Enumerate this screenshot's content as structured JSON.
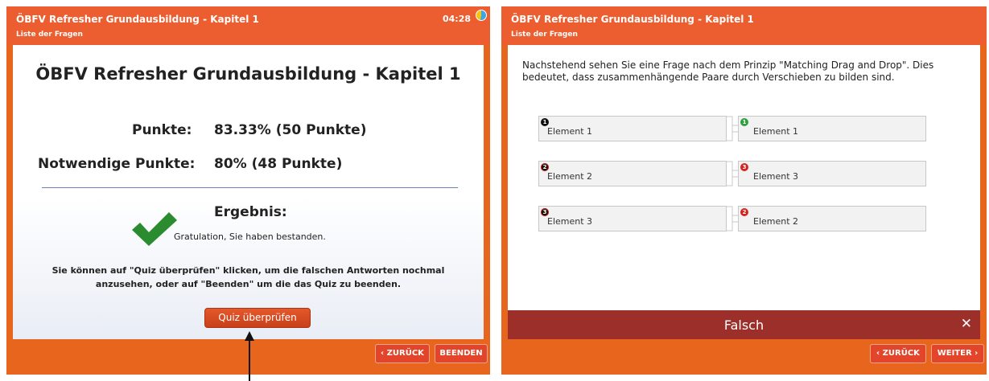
{
  "left": {
    "header": {
      "title": "ÖBFV Refresher Grundausbildung - Kapitel 1",
      "subtitle": "Liste der Fragen",
      "timer": "04:28"
    },
    "main_title": "ÖBFV Refresher Grundausbildung - Kapitel 1",
    "points_label": "Punkte:",
    "points_value": "83.33% (50 Punkte)",
    "required_label": "Notwendige Punkte:",
    "required_value": "80% (48 Punkte)",
    "result_title": "Ergebnis:",
    "result_message": "Gratulation, Sie haben bestanden.",
    "info_text": "Sie können auf \"Quiz überprüfen\" klicken, um die falschen Antworten nochmal anzusehen, oder auf \"Beenden\" um die das Quiz zu beenden.",
    "review_button": "Quiz überprüfen",
    "back_button": "‹ ZURÜCK",
    "finish_button": "BEENDEN"
  },
  "right": {
    "header": {
      "title": "ÖBFV Refresher Grundausbildung - Kapitel 1",
      "subtitle": "Liste der Fragen"
    },
    "question": "Nachstehend sehen Sie eine Frage nach dem Prinzip \"Matching Drag and Drop\". Dies bedeutet, dass zusammenhängende Paare durch Verschieben zu bilden sind.",
    "pairs": [
      {
        "left_label": "Element 1",
        "left_badge": "1",
        "right_label": "Element 1",
        "right_badge": "1",
        "right_status": "correct"
      },
      {
        "left_label": "Element 2",
        "left_badge": "2",
        "right_label": "Element 3",
        "right_badge": "3",
        "right_status": "wrong"
      },
      {
        "left_label": "Element 3",
        "left_badge": "3",
        "right_label": "Element 2",
        "right_badge": "2",
        "right_status": "wrong"
      }
    ],
    "feedback": "Falsch",
    "close_symbol": "✕",
    "back_button": "‹ ZURÜCK",
    "next_button": "WEITER ›"
  },
  "colors": {
    "frame": "#e8651e",
    "header": "#ec5d2f",
    "wrong_bar": "#9c2f2a",
    "correct_badge": "#2e9e3e",
    "wrong_badge": "#d3241e",
    "check_green": "#2a8c2f"
  },
  "icons": [
    "timer-pie-icon",
    "checkmark-icon",
    "close-icon",
    "pointer-arrow-icon"
  ]
}
